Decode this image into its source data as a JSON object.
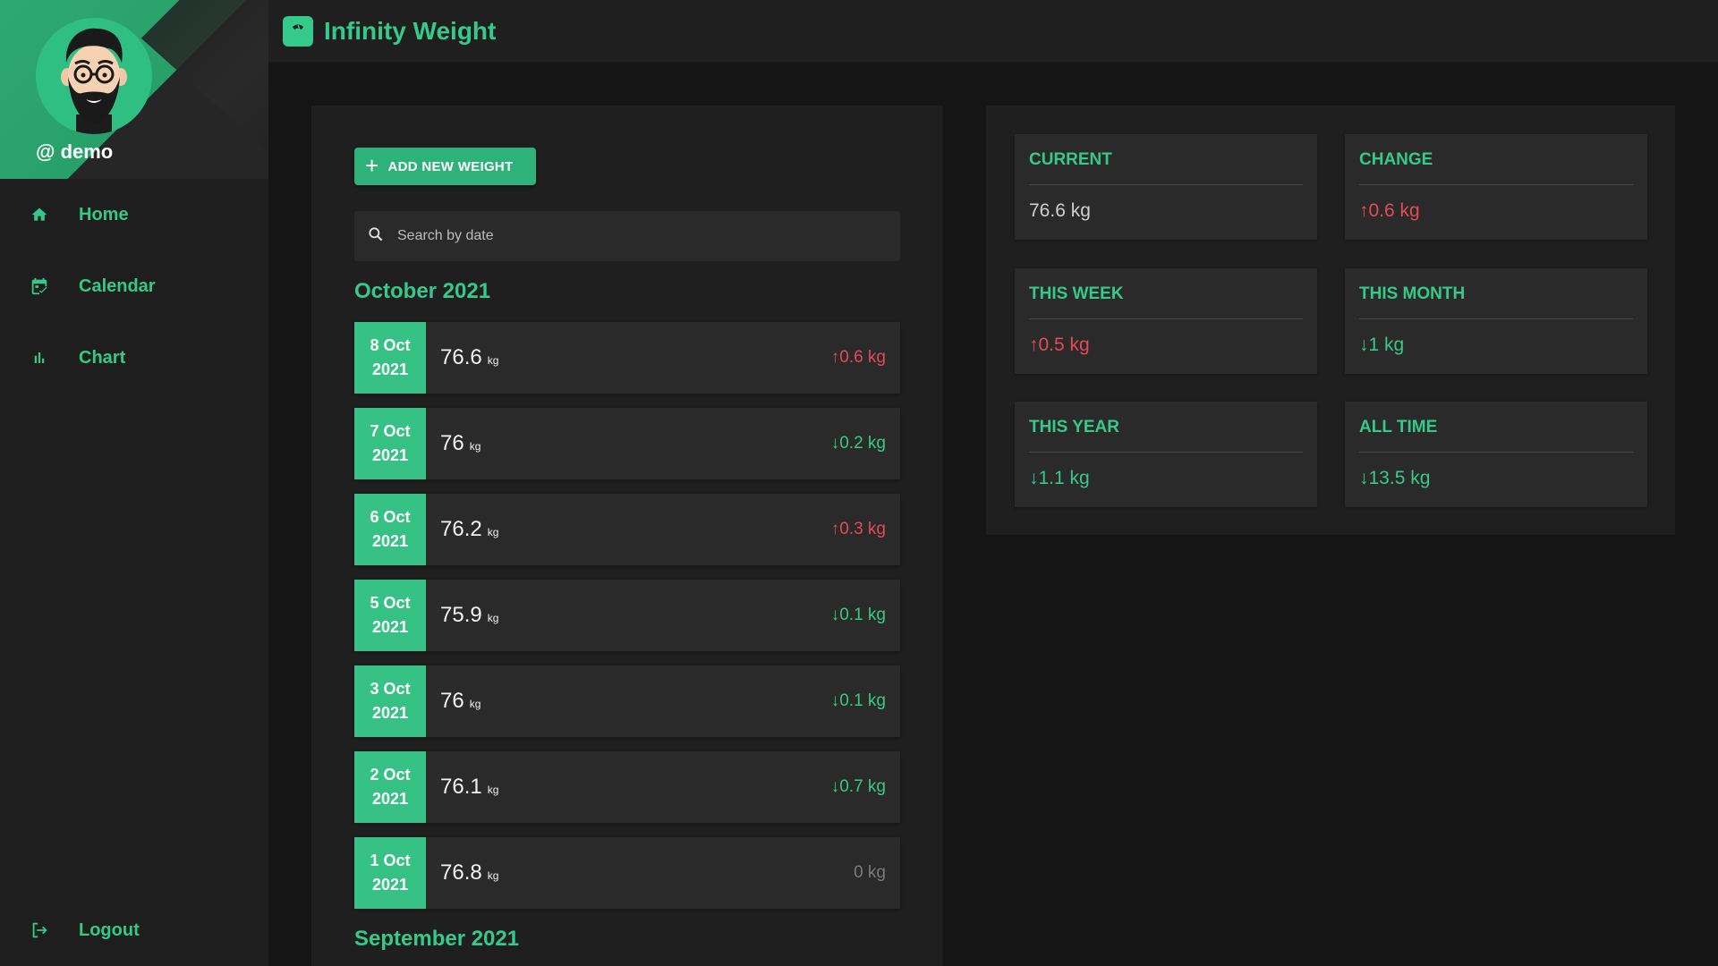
{
  "app": {
    "title": "Infinity Weight"
  },
  "sidebar": {
    "username": "@ demo",
    "nav": [
      {
        "label": "Home",
        "icon": "home-icon"
      },
      {
        "label": "Calendar",
        "icon": "calendar-icon"
      },
      {
        "label": "Chart",
        "icon": "bar-chart-icon"
      }
    ],
    "logout_label": "Logout"
  },
  "list": {
    "add_label": "ADD NEW WEIGHT",
    "search_placeholder": "Search by date",
    "months": [
      "October 2021",
      "September 2021"
    ],
    "rows": [
      {
        "day": "8 Oct",
        "year": "2021",
        "weight": "76.6",
        "unit": "kg",
        "arrow": "↑",
        "delta": "0.6 kg",
        "trend": "up"
      },
      {
        "day": "7 Oct",
        "year": "2021",
        "weight": "76",
        "unit": "kg",
        "arrow": "↓",
        "delta": "0.2 kg",
        "trend": "down"
      },
      {
        "day": "6 Oct",
        "year": "2021",
        "weight": "76.2",
        "unit": "kg",
        "arrow": "↑",
        "delta": "0.3 kg",
        "trend": "up"
      },
      {
        "day": "5 Oct",
        "year": "2021",
        "weight": "75.9",
        "unit": "kg",
        "arrow": "↓",
        "delta": "0.1 kg",
        "trend": "down"
      },
      {
        "day": "3 Oct",
        "year": "2021",
        "weight": "76",
        "unit": "kg",
        "arrow": "↓",
        "delta": "0.1 kg",
        "trend": "down"
      },
      {
        "day": "2 Oct",
        "year": "2021",
        "weight": "76.1",
        "unit": "kg",
        "arrow": "↓",
        "delta": "0.7 kg",
        "trend": "down"
      },
      {
        "day": "1 Oct",
        "year": "2021",
        "weight": "76.8",
        "unit": "kg",
        "arrow": "",
        "delta": "0  kg",
        "trend": "neutral"
      }
    ]
  },
  "stats": [
    {
      "title": "CURRENT",
      "arrow": "",
      "value": "76.6 kg",
      "trend": "plain"
    },
    {
      "title": "CHANGE",
      "arrow": "↑",
      "value": "0.6 kg",
      "trend": "up"
    },
    {
      "title": "THIS WEEK",
      "arrow": "↑",
      "value": "0.5 kg",
      "trend": "up"
    },
    {
      "title": "THIS MONTH",
      "arrow": "↓",
      "value": "1 kg",
      "trend": "down"
    },
    {
      "title": "THIS YEAR",
      "arrow": "↓",
      "value": "1.1 kg",
      "trend": "down"
    },
    {
      "title": "ALL TIME",
      "arrow": "↓",
      "value": "13.5 kg",
      "trend": "down"
    }
  ],
  "colors": {
    "accent": "#35c98b",
    "up": "#e24b57",
    "down": "#35c98b",
    "background": "#151515",
    "panel": "#1f1f1f",
    "card": "#2a2a2a"
  }
}
